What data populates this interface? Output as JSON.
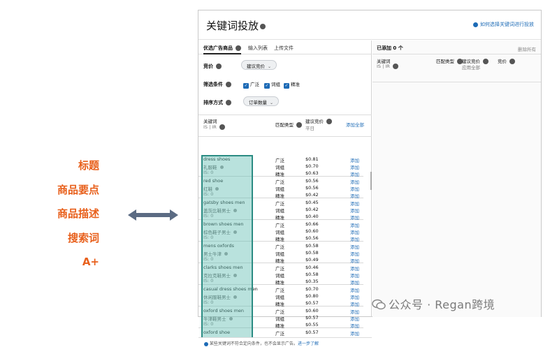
{
  "side_labels": [
    "标题",
    "商品要点",
    "商品描述",
    "搜索词",
    "A+"
  ],
  "panel": {
    "title": "关键词投放",
    "help_link": "如何选择关键词进行投放"
  },
  "tabs": [
    "优选广告商品",
    "输入列表",
    "上传文件"
  ],
  "form": {
    "bid_label": "竞价",
    "bid_select": "建议竞价",
    "filter_label": "筛选条件",
    "filters": [
      "广泛",
      "词组",
      "精准"
    ],
    "sort_label": "排序方式",
    "sort_select": "订单数量"
  },
  "table_header": {
    "keyword": "关键词",
    "keyword_sub": "IS | IR",
    "match_type": "匹配类型",
    "bid": "建议竞价",
    "bid_sub": "平日",
    "add_all": "添加全部"
  },
  "top_partial": {
    "bid": "$0.55"
  },
  "keywords": [
    {
      "en": "dress shoes",
      "cn": "礼服鞋",
      "is": "IS: 0",
      "rows": [
        [
          "广泛",
          "$0.81"
        ],
        [
          "词组",
          "$0.70"
        ],
        [
          "精准",
          "$0.63"
        ]
      ]
    },
    {
      "en": "red shoe",
      "cn": "红鞋",
      "is": "IS: 0",
      "rows": [
        [
          "广泛",
          "$0.56"
        ],
        [
          "词组",
          "$0.56"
        ],
        [
          "精准",
          "$0.42"
        ]
      ]
    },
    {
      "en": "gatsby shoes men",
      "cn": "盖茨比鞋男士",
      "is": "IS: 0",
      "rows": [
        [
          "广泛",
          "$0.45"
        ],
        [
          "词组",
          "$0.42"
        ],
        [
          "精准",
          "$0.40"
        ]
      ]
    },
    {
      "en": "brown shoes men",
      "cn": "棕色鞋子男士",
      "is": "IS: 0",
      "rows": [
        [
          "广泛",
          "$0.66"
        ],
        [
          "词组",
          "$0.60"
        ],
        [
          "精准",
          "$0.56"
        ]
      ]
    },
    {
      "en": "mens oxfords",
      "cn": "男士牛津",
      "is": "IS: 0",
      "rows": [
        [
          "广泛",
          "$0.58"
        ],
        [
          "词组",
          "$0.58"
        ],
        [
          "精准",
          "$0.49"
        ]
      ]
    },
    {
      "en": "clarks shoes men",
      "cn": "克拉克鞋男士",
      "is": "IS: 0",
      "rows": [
        [
          "广泛",
          "$0.46"
        ],
        [
          "词组",
          "$0.58"
        ],
        [
          "精准",
          "$0.35"
        ]
      ]
    },
    {
      "en": "casual dress shoes men",
      "cn": "休闲服鞋男士",
      "is": "IS: 0",
      "rows": [
        [
          "广泛",
          "$0.70"
        ],
        [
          "词组",
          "$0.80"
        ],
        [
          "精准",
          "$0.57"
        ]
      ]
    },
    {
      "en": "oxford shoes men",
      "cn": "牛津鞋男士",
      "is": "IS: 0",
      "rows": [
        [
          "广泛",
          "$0.60"
        ],
        [
          "词组",
          "$0.57"
        ],
        [
          "精准",
          "$0.55"
        ]
      ]
    },
    {
      "en": "oxford shoe",
      "cn": "",
      "is": "",
      "rows": [
        [
          "广泛",
          "$0.57"
        ]
      ]
    }
  ],
  "add_label": "添加",
  "footer": {
    "text": "某些关键词不符合定向条件，也不会显示广告。",
    "link": "进一步了解"
  },
  "right": {
    "added": "已添加 0 个",
    "remove_all": "删除所有",
    "col_keyword": "关键词",
    "col_keyword_sub": "IS | IR",
    "col_match": "匹配类型",
    "col_bid": "建议竞价",
    "col_bid_sub": "应用全部",
    "col_bid2": "竞价"
  },
  "watermark": "公众号 · Regan跨境"
}
